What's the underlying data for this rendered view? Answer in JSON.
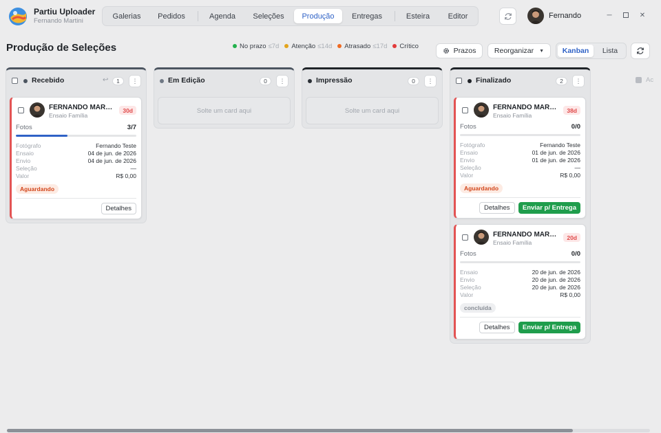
{
  "app": {
    "title": "Partiu Uploader",
    "subtitle": "Fernando Martini"
  },
  "nav": {
    "items": [
      {
        "label": "Galerias"
      },
      {
        "label": "Pedidos"
      },
      {
        "label": "Agenda"
      },
      {
        "label": "Seleções"
      },
      {
        "label": "Produção",
        "active": true
      },
      {
        "label": "Entregas"
      },
      {
        "label": "Esteira"
      },
      {
        "label": "Editor"
      }
    ]
  },
  "user": {
    "name": "Fernando"
  },
  "page": {
    "title": "Produção de Seleções"
  },
  "legend": [
    {
      "label": "No prazo",
      "threshold": "≤7d",
      "color": "#22b14c"
    },
    {
      "label": "Atenção",
      "threshold": "≤14d",
      "color": "#e3a41c"
    },
    {
      "label": "Atrasado",
      "threshold": "≤17d",
      "color": "#ef6a22"
    },
    {
      "label": "Crítico",
      "threshold": "",
      "color": "#e23b3b"
    }
  ],
  "toolbar": {
    "prazos_label": "Prazos",
    "reorganizar_label": "Reorganizar",
    "view_kanban": "Kanban",
    "view_lista": "Lista"
  },
  "columns": [
    {
      "title": "Recebido",
      "count": "1",
      "dot_color": "#4c5560",
      "cards": [
        {
          "name": "FERNANDO MARTINI",
          "sub": "Ensaio Família",
          "age": "30d",
          "photos_label": "Fotos",
          "photos_value": "3/7",
          "progress": 0.43,
          "fields": [
            {
              "label": "Fotógrafo",
              "value": "Fernando Teste"
            },
            {
              "label": "Ensaio",
              "value": "04 de jun. de 2026"
            },
            {
              "label": "Envio",
              "value": "04 de jun. de 2026"
            },
            {
              "label": "Seleção",
              "value": "—"
            },
            {
              "label": "Valor",
              "value": "R$ 0,00"
            }
          ],
          "status": "Aguardando",
          "details_label": "Detalhes"
        }
      ]
    },
    {
      "title": "Em Edição",
      "count": "0",
      "dot_color": "#6f7884",
      "drop_text": "Solte um card aqui"
    },
    {
      "title": "Impressão",
      "count": "0",
      "dot_color": "#2b3036",
      "drop_text": "Solte um card aqui"
    },
    {
      "title": "Finalizado",
      "count": "2",
      "dot_color": "#1f2328",
      "cards": [
        {
          "name": "FERNANDO MARTINI",
          "sub": "Ensaio Família",
          "age": "38d",
          "photos_label": "Fotos",
          "photos_value": "0/0",
          "progress": 0,
          "fields": [
            {
              "label": "Fotógrafo",
              "value": "Fernando Teste"
            },
            {
              "label": "Ensaio",
              "value": "01 de jun. de 2026"
            },
            {
              "label": "Envio",
              "value": "01 de jun. de 2026"
            },
            {
              "label": "Seleção",
              "value": "—"
            },
            {
              "label": "Valor",
              "value": "R$ 0,00"
            }
          ],
          "status": "Aguardando",
          "details_label": "Detalhes",
          "send_label": "Enviar p/ Entrega"
        },
        {
          "name": "FERNANDO MARTINI",
          "sub": "Ensaio Família",
          "age": "20d",
          "photos_label": "Fotos",
          "photos_value": "0/0",
          "progress": 0,
          "fields": [
            {
              "label": "Ensaio",
              "value": "20 de jun. de 2026"
            },
            {
              "label": "Envio",
              "value": "20 de jun. de 2026"
            },
            {
              "label": "Seleção",
              "value": "20 de jun. de 2026"
            },
            {
              "label": "Valor",
              "value": "R$ 0,00"
            }
          ],
          "status": "concluída",
          "details_label": "Detalhes",
          "send_label": "Enviar p/ Entrega"
        }
      ]
    }
  ],
  "add_column_label": "Ac"
}
